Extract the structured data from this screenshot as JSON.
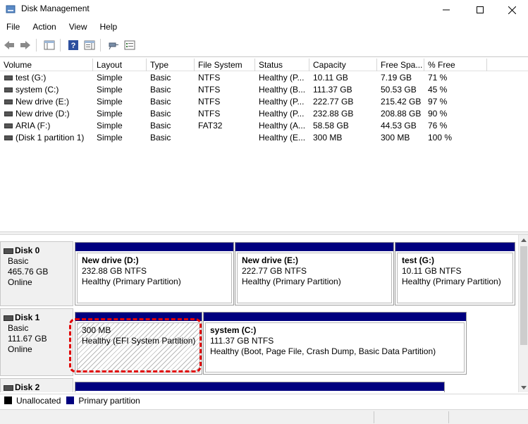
{
  "window": {
    "title": "Disk Management"
  },
  "menu": {
    "file": "File",
    "action": "Action",
    "view": "View",
    "help": "Help"
  },
  "columns": [
    "Volume",
    "Layout",
    "Type",
    "File System",
    "Status",
    "Capacity",
    "Free Spa...",
    "% Free"
  ],
  "volumes": [
    {
      "volume": "test (G:)",
      "layout": "Simple",
      "type": "Basic",
      "fs": "NTFS",
      "status": "Healthy (P...",
      "capacity": "10.11 GB",
      "free": "7.19 GB",
      "pct": "71 %"
    },
    {
      "volume": "system (C:)",
      "layout": "Simple",
      "type": "Basic",
      "fs": "NTFS",
      "status": "Healthy (B...",
      "capacity": "111.37 GB",
      "free": "50.53 GB",
      "pct": "45 %"
    },
    {
      "volume": "New drive (E:)",
      "layout": "Simple",
      "type": "Basic",
      "fs": "NTFS",
      "status": "Healthy (P...",
      "capacity": "222.77 GB",
      "free": "215.42 GB",
      "pct": "97 %"
    },
    {
      "volume": "New drive (D:)",
      "layout": "Simple",
      "type": "Basic",
      "fs": "NTFS",
      "status": "Healthy (P...",
      "capacity": "232.88 GB",
      "free": "208.88 GB",
      "pct": "90 %"
    },
    {
      "volume": "ARIA (F:)",
      "layout": "Simple",
      "type": "Basic",
      "fs": "FAT32",
      "status": "Healthy (A...",
      "capacity": "58.58 GB",
      "free": "44.53 GB",
      "pct": "76 %"
    },
    {
      "volume": "(Disk 1 partition 1)",
      "layout": "Simple",
      "type": "Basic",
      "fs": "",
      "status": "Healthy (E...",
      "capacity": "300 MB",
      "free": "300 MB",
      "pct": "100 %"
    }
  ],
  "disks": [
    {
      "name": "Disk 0",
      "type": "Basic",
      "size": "465.76 GB",
      "state": "Online",
      "partitions": [
        {
          "name": "New drive  (D:)",
          "size": "232.88 GB NTFS",
          "status": "Healthy (Primary Partition)"
        },
        {
          "name": "New drive  (E:)",
          "size": "222.77 GB NTFS",
          "status": "Healthy (Primary Partition)"
        },
        {
          "name": "test  (G:)",
          "size": "10.11 GB NTFS",
          "status": "Healthy (Primary Partition)"
        }
      ]
    },
    {
      "name": "Disk 1",
      "type": "Basic",
      "size": "111.67 GB",
      "state": "Online",
      "partitions": [
        {
          "name": "",
          "size": "300 MB",
          "status": "Healthy (EFI System Partition)"
        },
        {
          "name": "system  (C:)",
          "size": "111.37 GB NTFS",
          "status": "Healthy (Boot, Page File, Crash Dump, Basic Data Partition)"
        }
      ]
    },
    {
      "name": "Disk 2"
    }
  ],
  "legend": {
    "unallocated": "Unallocated",
    "primary": "Primary partition"
  },
  "colors": {
    "primary_bar": "#00007f",
    "unallocated": "#000000",
    "highlight": "#e00000"
  },
  "icons": [
    "back-icon",
    "forward-icon",
    "show-hide-console-tree-icon",
    "help-icon",
    "show-hide-action-pane-icon",
    "connect-icon",
    "properties-icon",
    "minimize-icon",
    "maximize-icon",
    "close-icon"
  ]
}
